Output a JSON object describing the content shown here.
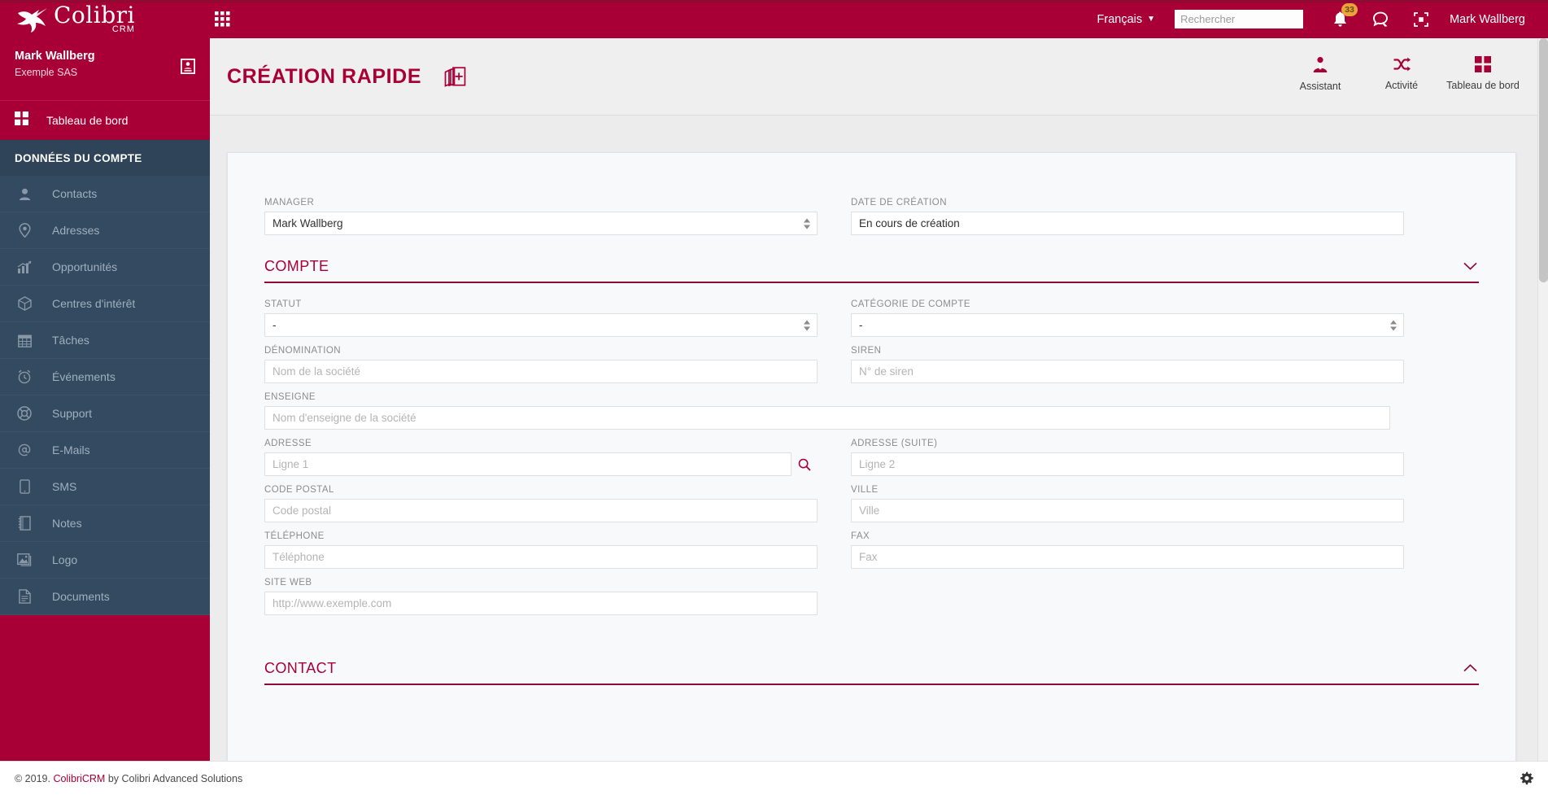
{
  "topbar": {
    "logo_name": "Colibri",
    "logo_sub": "CRM",
    "apps_icon": "grid-apps-icon",
    "language": "Français",
    "search_placeholder": "Rechercher",
    "search_value": "",
    "notifications_count": "33",
    "username": "Mark Wallberg"
  },
  "sidebar": {
    "user_name": "Mark Wallberg",
    "user_org": "Exemple SAS",
    "dashboard_label": "Tableau de bord",
    "section_title": "DONNÉES DU COMPTE",
    "items": [
      {
        "label": "Contacts",
        "icon": "user-icon"
      },
      {
        "label": "Adresses",
        "icon": "map-pin-icon"
      },
      {
        "label": "Opportunités",
        "icon": "chart-icon"
      },
      {
        "label": "Centres d'intérêt",
        "icon": "cube-icon"
      },
      {
        "label": "Tâches",
        "icon": "calendar-icon"
      },
      {
        "label": "Événements",
        "icon": "alarm-clock-icon"
      },
      {
        "label": "Support",
        "icon": "life-ring-icon"
      },
      {
        "label": "E-Mails",
        "icon": "at-icon"
      },
      {
        "label": "SMS",
        "icon": "mobile-icon"
      },
      {
        "label": "Notes",
        "icon": "notebook-icon"
      },
      {
        "label": "Logo",
        "icon": "image-icon"
      },
      {
        "label": "Documents",
        "icon": "document-icon"
      }
    ]
  },
  "page": {
    "title": "CRÉATION RAPIDE",
    "quick_create_icon": "pages-plus-icon",
    "actions": [
      {
        "label": "Assistant",
        "icon": "assistant-icon"
      },
      {
        "label": "Activité",
        "icon": "shuffle-icon"
      },
      {
        "label": "Tableau de bord",
        "icon": "grid-icon"
      }
    ]
  },
  "form": {
    "manager": {
      "label": "MANAGER",
      "value": "Mark Wallberg"
    },
    "creation_date": {
      "label": "DATE DE CRÉATION",
      "value": "En cours de création"
    },
    "compte_section": {
      "title": "COMPTE",
      "chevron": "chevron-down-icon"
    },
    "statut": {
      "label": "STATUT",
      "value": "-"
    },
    "categorie": {
      "label": "CATÉGORIE DE COMPTE",
      "value": "-"
    },
    "denomination": {
      "label": "DÉNOMINATION",
      "placeholder": "Nom de la société",
      "value": ""
    },
    "siren": {
      "label": "SIREN",
      "placeholder": "N° de siren",
      "value": ""
    },
    "enseigne": {
      "label": "ENSEIGNE",
      "placeholder": "Nom d'enseigne de la société",
      "value": ""
    },
    "adresse": {
      "label": "ADRESSE",
      "placeholder": "Ligne 1",
      "value": "",
      "search_icon": "search-icon"
    },
    "adresse_suite": {
      "label": "ADRESSE (SUITE)",
      "placeholder": "Ligne 2",
      "value": ""
    },
    "code_postal": {
      "label": "CODE POSTAL",
      "placeholder": "Code postal",
      "value": ""
    },
    "ville": {
      "label": "VILLE",
      "placeholder": "Ville",
      "value": ""
    },
    "telephone": {
      "label": "TÉLÉPHONE",
      "placeholder": "Téléphone",
      "value": ""
    },
    "fax": {
      "label": "FAX",
      "placeholder": "Fax",
      "value": ""
    },
    "site_web": {
      "label": "SITE WEB",
      "placeholder": "http://www.exemple.com",
      "value": ""
    },
    "contact_section": {
      "title": "CONTACT",
      "chevron": "chevron-up-icon"
    }
  },
  "footer": {
    "copyright": "© 2019. ",
    "brand": "ColibriCRM",
    "suffix": " by Colibri Advanced Solutions",
    "settings_icon": "gear-icon"
  },
  "colors": {
    "brand": "#a80036",
    "brand_dark": "#8e0b34",
    "sidebar_dark": "#334a61",
    "sidebar_section": "#2f4459",
    "badge": "#e8a33d"
  }
}
